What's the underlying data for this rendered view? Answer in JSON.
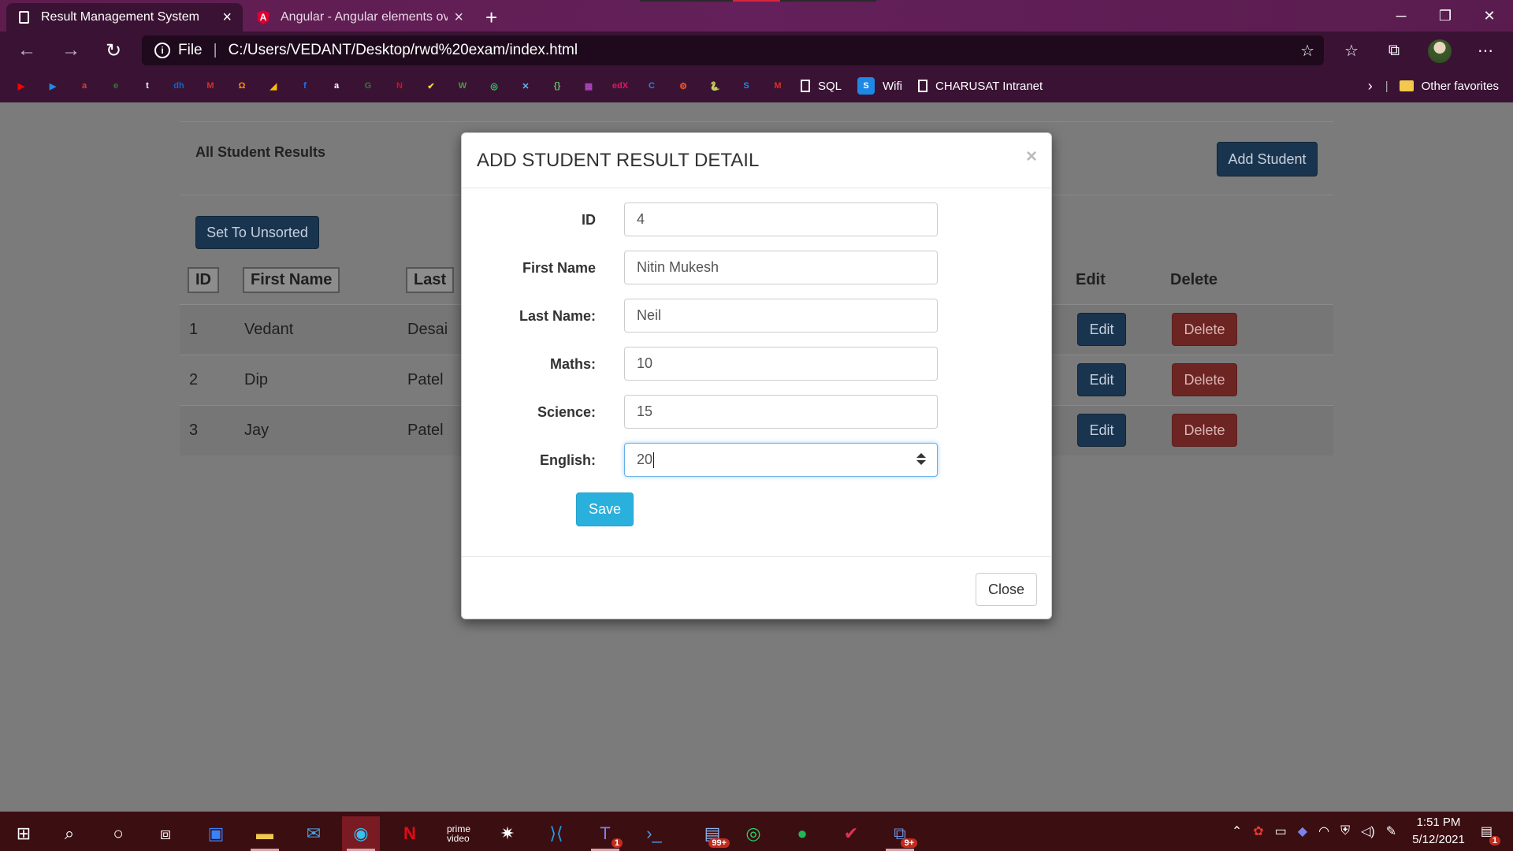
{
  "browser": {
    "tabs": [
      {
        "title": "Result Management System",
        "active": true
      },
      {
        "title": "Angular - Angular elements over",
        "active": false
      }
    ],
    "address": {
      "scheme_label": "File",
      "url": "C:/Users/VEDANT/Desktop/rwd%20exam/index.html"
    },
    "bookmarks": {
      "items": [
        {
          "icon": "youtube-icon",
          "color": "#ff0000",
          "glyph": "▶"
        },
        {
          "icon": "play-icon",
          "color": "#1e88e5",
          "glyph": "▶"
        },
        {
          "icon": "airtel-icon",
          "color": "#e53935",
          "glyph": "a"
        },
        {
          "icon": "edge-icon",
          "color": "#2e7d32",
          "glyph": "e"
        },
        {
          "icon": "tata-icon",
          "color": "#ffffff",
          "glyph": "t"
        },
        {
          "icon": "dh-icon",
          "color": "#1565c0",
          "glyph": "dh"
        },
        {
          "icon": "gmail-icon",
          "color": "#d93025",
          "glyph": "M"
        },
        {
          "icon": "hackerrank-icon",
          "color": "#ff8f00",
          "glyph": "Ω"
        },
        {
          "icon": "drive-icon",
          "color": "#fbbc04",
          "glyph": "◢"
        },
        {
          "icon": "facebook-icon",
          "color": "#1877f2",
          "glyph": "f"
        },
        {
          "icon": "amazon-icon",
          "color": "#ffffff",
          "glyph": "a"
        },
        {
          "icon": "green-icon",
          "color": "#2e7d32",
          "glyph": "G"
        },
        {
          "icon": "netflix-icon",
          "color": "#e50914",
          "glyph": "N"
        },
        {
          "icon": "check-icon",
          "color": "#fdd835",
          "glyph": "✔"
        },
        {
          "icon": "w-icon",
          "color": "#43a047",
          "glyph": "W"
        },
        {
          "icon": "whatsapp-icon",
          "color": "#25d366",
          "glyph": "◎"
        },
        {
          "icon": "tool-icon",
          "color": "#64b5f6",
          "glyph": "✕"
        },
        {
          "icon": "code-icon",
          "color": "#66bb6a",
          "glyph": "{}"
        },
        {
          "icon": "app-icon",
          "color": "#ab47bc",
          "glyph": "▦"
        },
        {
          "icon": "edx-icon",
          "color": "#d81b60",
          "glyph": "edX"
        },
        {
          "icon": "c-icon",
          "color": "#1e88e5",
          "glyph": "C"
        },
        {
          "icon": "gear-icon",
          "color": "#ff5722",
          "glyph": "⚙"
        },
        {
          "icon": "python-icon",
          "color": "#3776ab",
          "glyph": "🐍"
        },
        {
          "icon": "s-icon",
          "color": "#1e88e5",
          "glyph": "S"
        },
        {
          "icon": "gmail-icon-2",
          "color": "#d93025",
          "glyph": "M"
        }
      ],
      "text_items": [
        {
          "icon": "page-icon",
          "label": "SQL"
        },
        {
          "icon": "wifi-icon",
          "label": "Wifi"
        },
        {
          "icon": "page-icon",
          "label": "CHARUSAT Intranet"
        }
      ],
      "other_favorites": "Other favorites"
    }
  },
  "page": {
    "panel_title": "All Student Results",
    "add_student_label": "Add Student",
    "set_unsorted_label": "Set To Unsorted",
    "columns": {
      "id": "ID",
      "first_name": "First Name",
      "last_name": "Last",
      "edit": "Edit",
      "delete": "Delete"
    },
    "rows": [
      {
        "id": "1",
        "first_name": "Vedant",
        "last_name": "Desai",
        "edit": "Edit",
        "delete": "Delete"
      },
      {
        "id": "2",
        "first_name": "Dip",
        "last_name": "Patel",
        "edit": "Edit",
        "delete": "Delete"
      },
      {
        "id": "3",
        "first_name": "Jay",
        "last_name": "Patel",
        "edit": "Edit",
        "delete": "Delete"
      }
    ]
  },
  "modal": {
    "title": "ADD STUDENT RESULT DETAIL",
    "close_x": "×",
    "fields": {
      "id": {
        "label": "ID",
        "value": "4"
      },
      "first_name": {
        "label": "First Name",
        "value": "Nitin Mukesh"
      },
      "last_name": {
        "label": "Last Name:",
        "value": "Neil"
      },
      "maths": {
        "label": "Maths:",
        "value": "10"
      },
      "science": {
        "label": "Science:",
        "value": "15"
      },
      "english": {
        "label": "English:",
        "value": "20"
      }
    },
    "save_label": "Save",
    "close_label": "Close"
  },
  "taskbar": {
    "clock_time": "1:51 PM",
    "clock_date": "5/12/2021",
    "badges": {
      "teams": "1",
      "files": "99+",
      "app": "9+",
      "notifications": "1"
    }
  }
}
